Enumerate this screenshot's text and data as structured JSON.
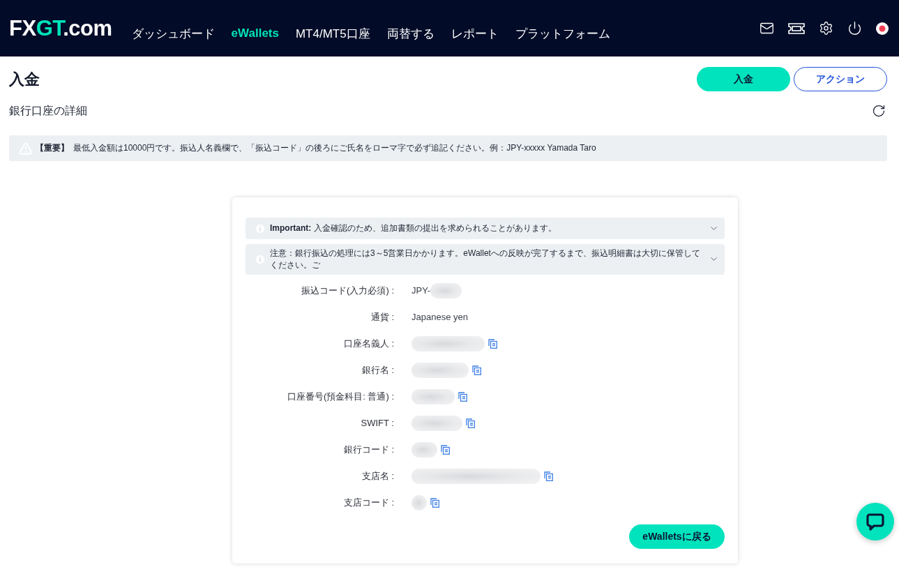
{
  "header": {
    "logo": [
      {
        "text": "FX",
        "kind": "plain"
      },
      {
        "text": "GT",
        "kind": "accent"
      },
      {
        "text": ".com",
        "kind": "plain"
      }
    ],
    "nav": [
      {
        "label": "ダッシュボード",
        "selected": false
      },
      {
        "label": "eWallets",
        "selected": true
      },
      {
        "label": "MT4/MT5口座",
        "selected": false
      },
      {
        "label": "両替する",
        "selected": false
      },
      {
        "label": "レポート",
        "selected": false
      },
      {
        "label": "プラットフォーム",
        "selected": false
      }
    ]
  },
  "page": {
    "title": "入金",
    "actions": [
      {
        "label": "入金",
        "kind": "primary"
      },
      {
        "label": "アクション",
        "kind": "outline"
      }
    ],
    "subtitle": "銀行口座の詳細"
  },
  "notice": {
    "tag": "【重要】",
    "text": "最低入金額は10000円です。振込人名義欄で、「振込コード」の後ろにご氏名をローマ字で必ず追記ください。例：JPY-xxxxx Yamada Taro"
  },
  "card": {
    "accordions": [
      {
        "text": "**Important:** 入金確認のため、追加書類の提出を求められることがあります。",
        "expanded": false
      },
      {
        "text": "注意：銀行振込の処理には3～5営業日かかります。eWalletへの反映が完了するまで、振込明細書は大切に保管してください。ご",
        "expanded": false
      }
    ],
    "rows": [
      {
        "label": "振込コード(入力必須) :",
        "value": "JPY-",
        "redacted": true,
        "copyable": false
      },
      {
        "label": "通貨 :",
        "value": "Japanese yen",
        "redacted": false,
        "copyable": false
      },
      {
        "label": "口座名義人 :",
        "redacted": true,
        "copyable": true
      },
      {
        "label": "銀行名 :",
        "redacted": true,
        "copyable": true
      },
      {
        "label": "口座番号(預金科目: 普通) :",
        "redacted": true,
        "copyable": true
      },
      {
        "label": "SWIFT :",
        "redacted": true,
        "copyable": true
      },
      {
        "label": "銀行コード :",
        "redacted": true,
        "copyable": true
      },
      {
        "label": "支店名 :",
        "redacted": true,
        "copyable": true
      },
      {
        "label": "支店コード :",
        "redacted": true,
        "copyable": true
      }
    ],
    "back_button": "eWalletsに戻る"
  }
}
